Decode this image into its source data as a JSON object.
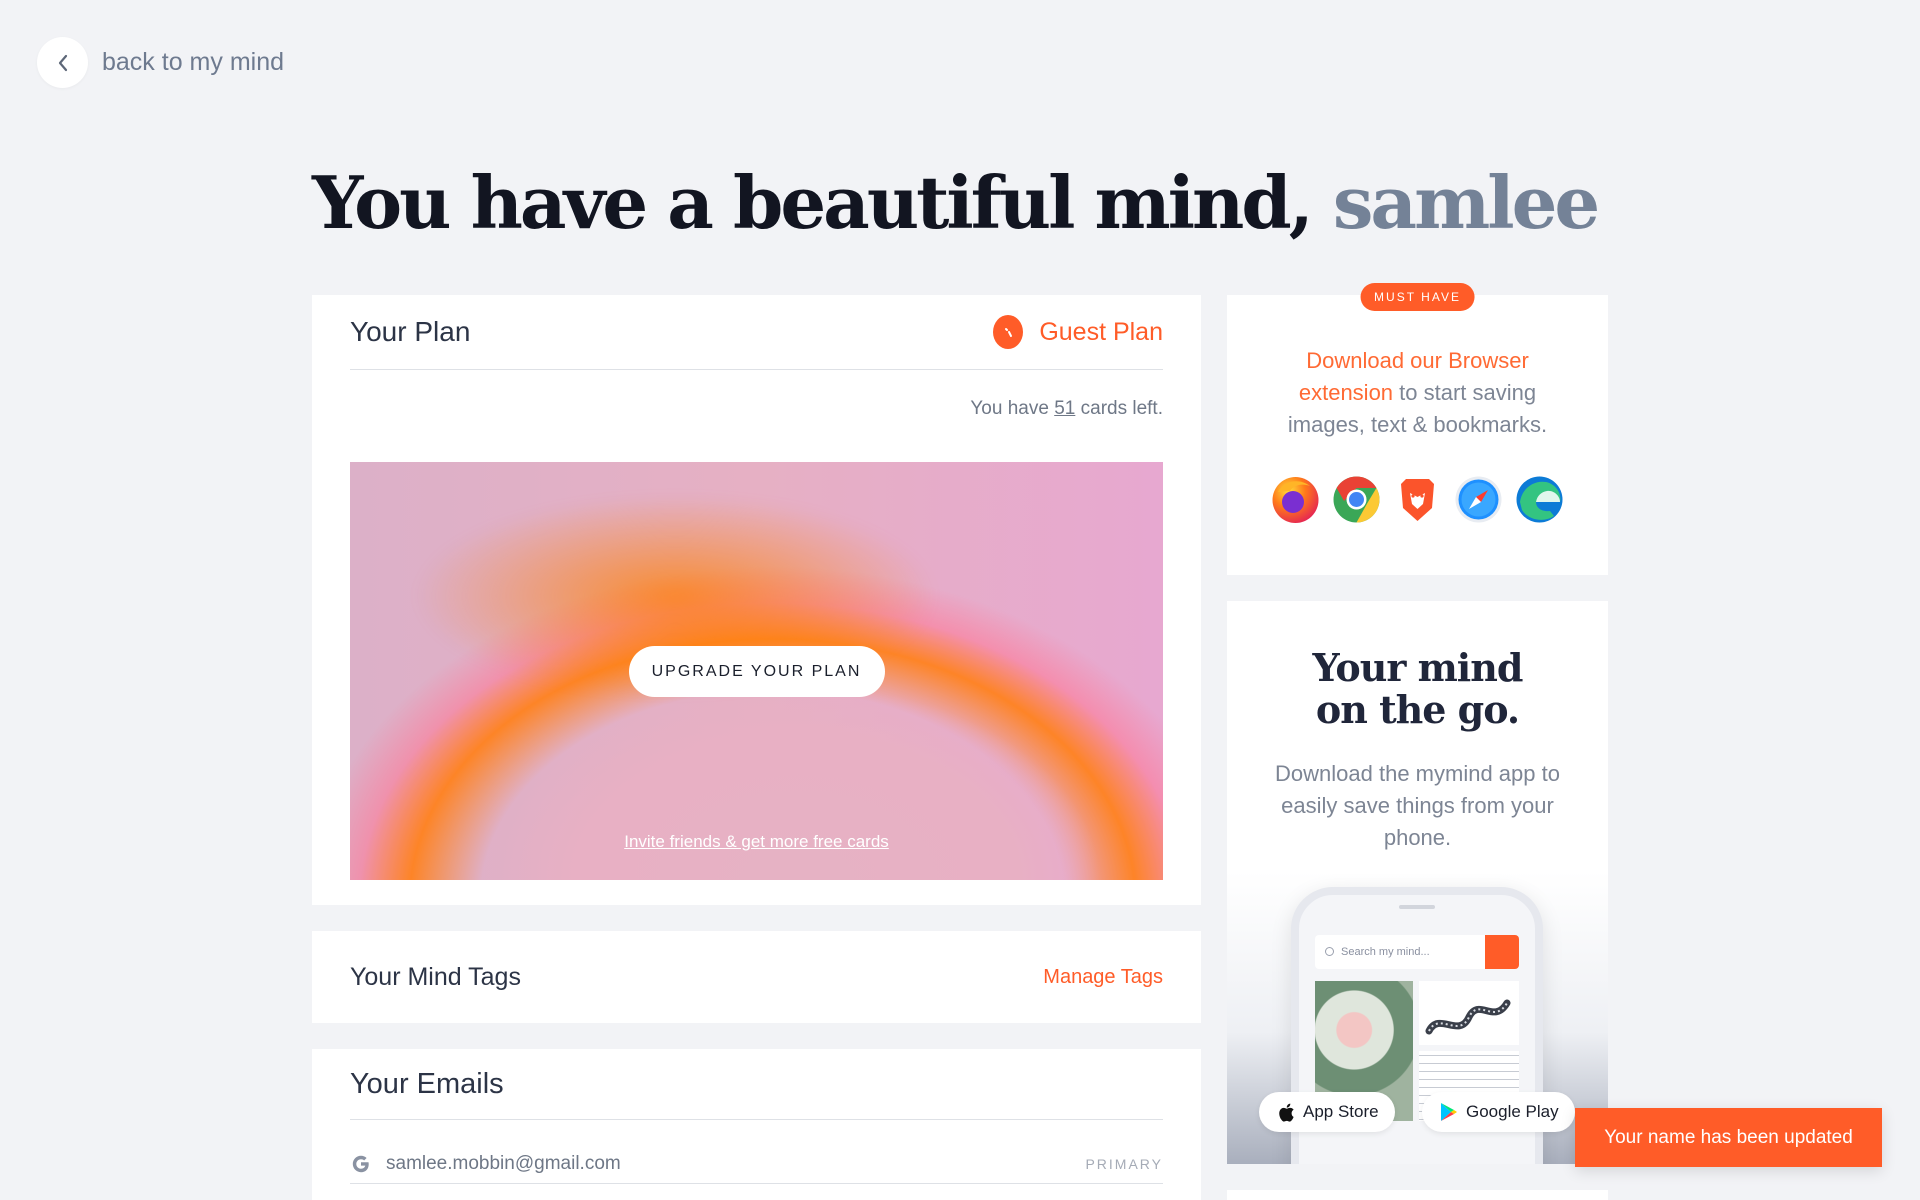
{
  "nav": {
    "back_label": "back to my mind"
  },
  "hero": {
    "prefix": "You have a beautiful mind,",
    "username": "samlee"
  },
  "plan": {
    "title": "Your Plan",
    "plan_name": "Guest Plan",
    "cards_left_prefix": "You have ",
    "cards_left_count": "51",
    "cards_left_suffix": " cards left.",
    "upgrade_label": "UPGRADE YOUR PLAN",
    "invite_label": "Invite friends & get more free cards"
  },
  "tags": {
    "title": "Your Mind Tags",
    "manage_label": "Manage Tags"
  },
  "emails": {
    "title": "Your Emails",
    "items": [
      {
        "address": "samlee.mobbin@gmail.com",
        "badge": "PRIMARY"
      }
    ]
  },
  "extension": {
    "badge": "MUST HAVE",
    "link_text": "Download our Browser extension",
    "rest_text": " to start saving images, text & bookmarks.",
    "browsers": [
      "firefox-icon",
      "chrome-icon",
      "brave-icon",
      "safari-icon",
      "edge-icon"
    ]
  },
  "mobile": {
    "title_line1": "Your mind",
    "title_line2": "on the go.",
    "subtitle": "Download the mymind app to easily save things from your phone.",
    "phone_search_placeholder": "Search my mind...",
    "app_store_label": "App Store",
    "google_play_label": "Google Play"
  },
  "toast": {
    "message": "Your name has been updated"
  },
  "colors": {
    "accent": "#ff5c28",
    "background": "#f2f3f6",
    "username": "#748297"
  }
}
